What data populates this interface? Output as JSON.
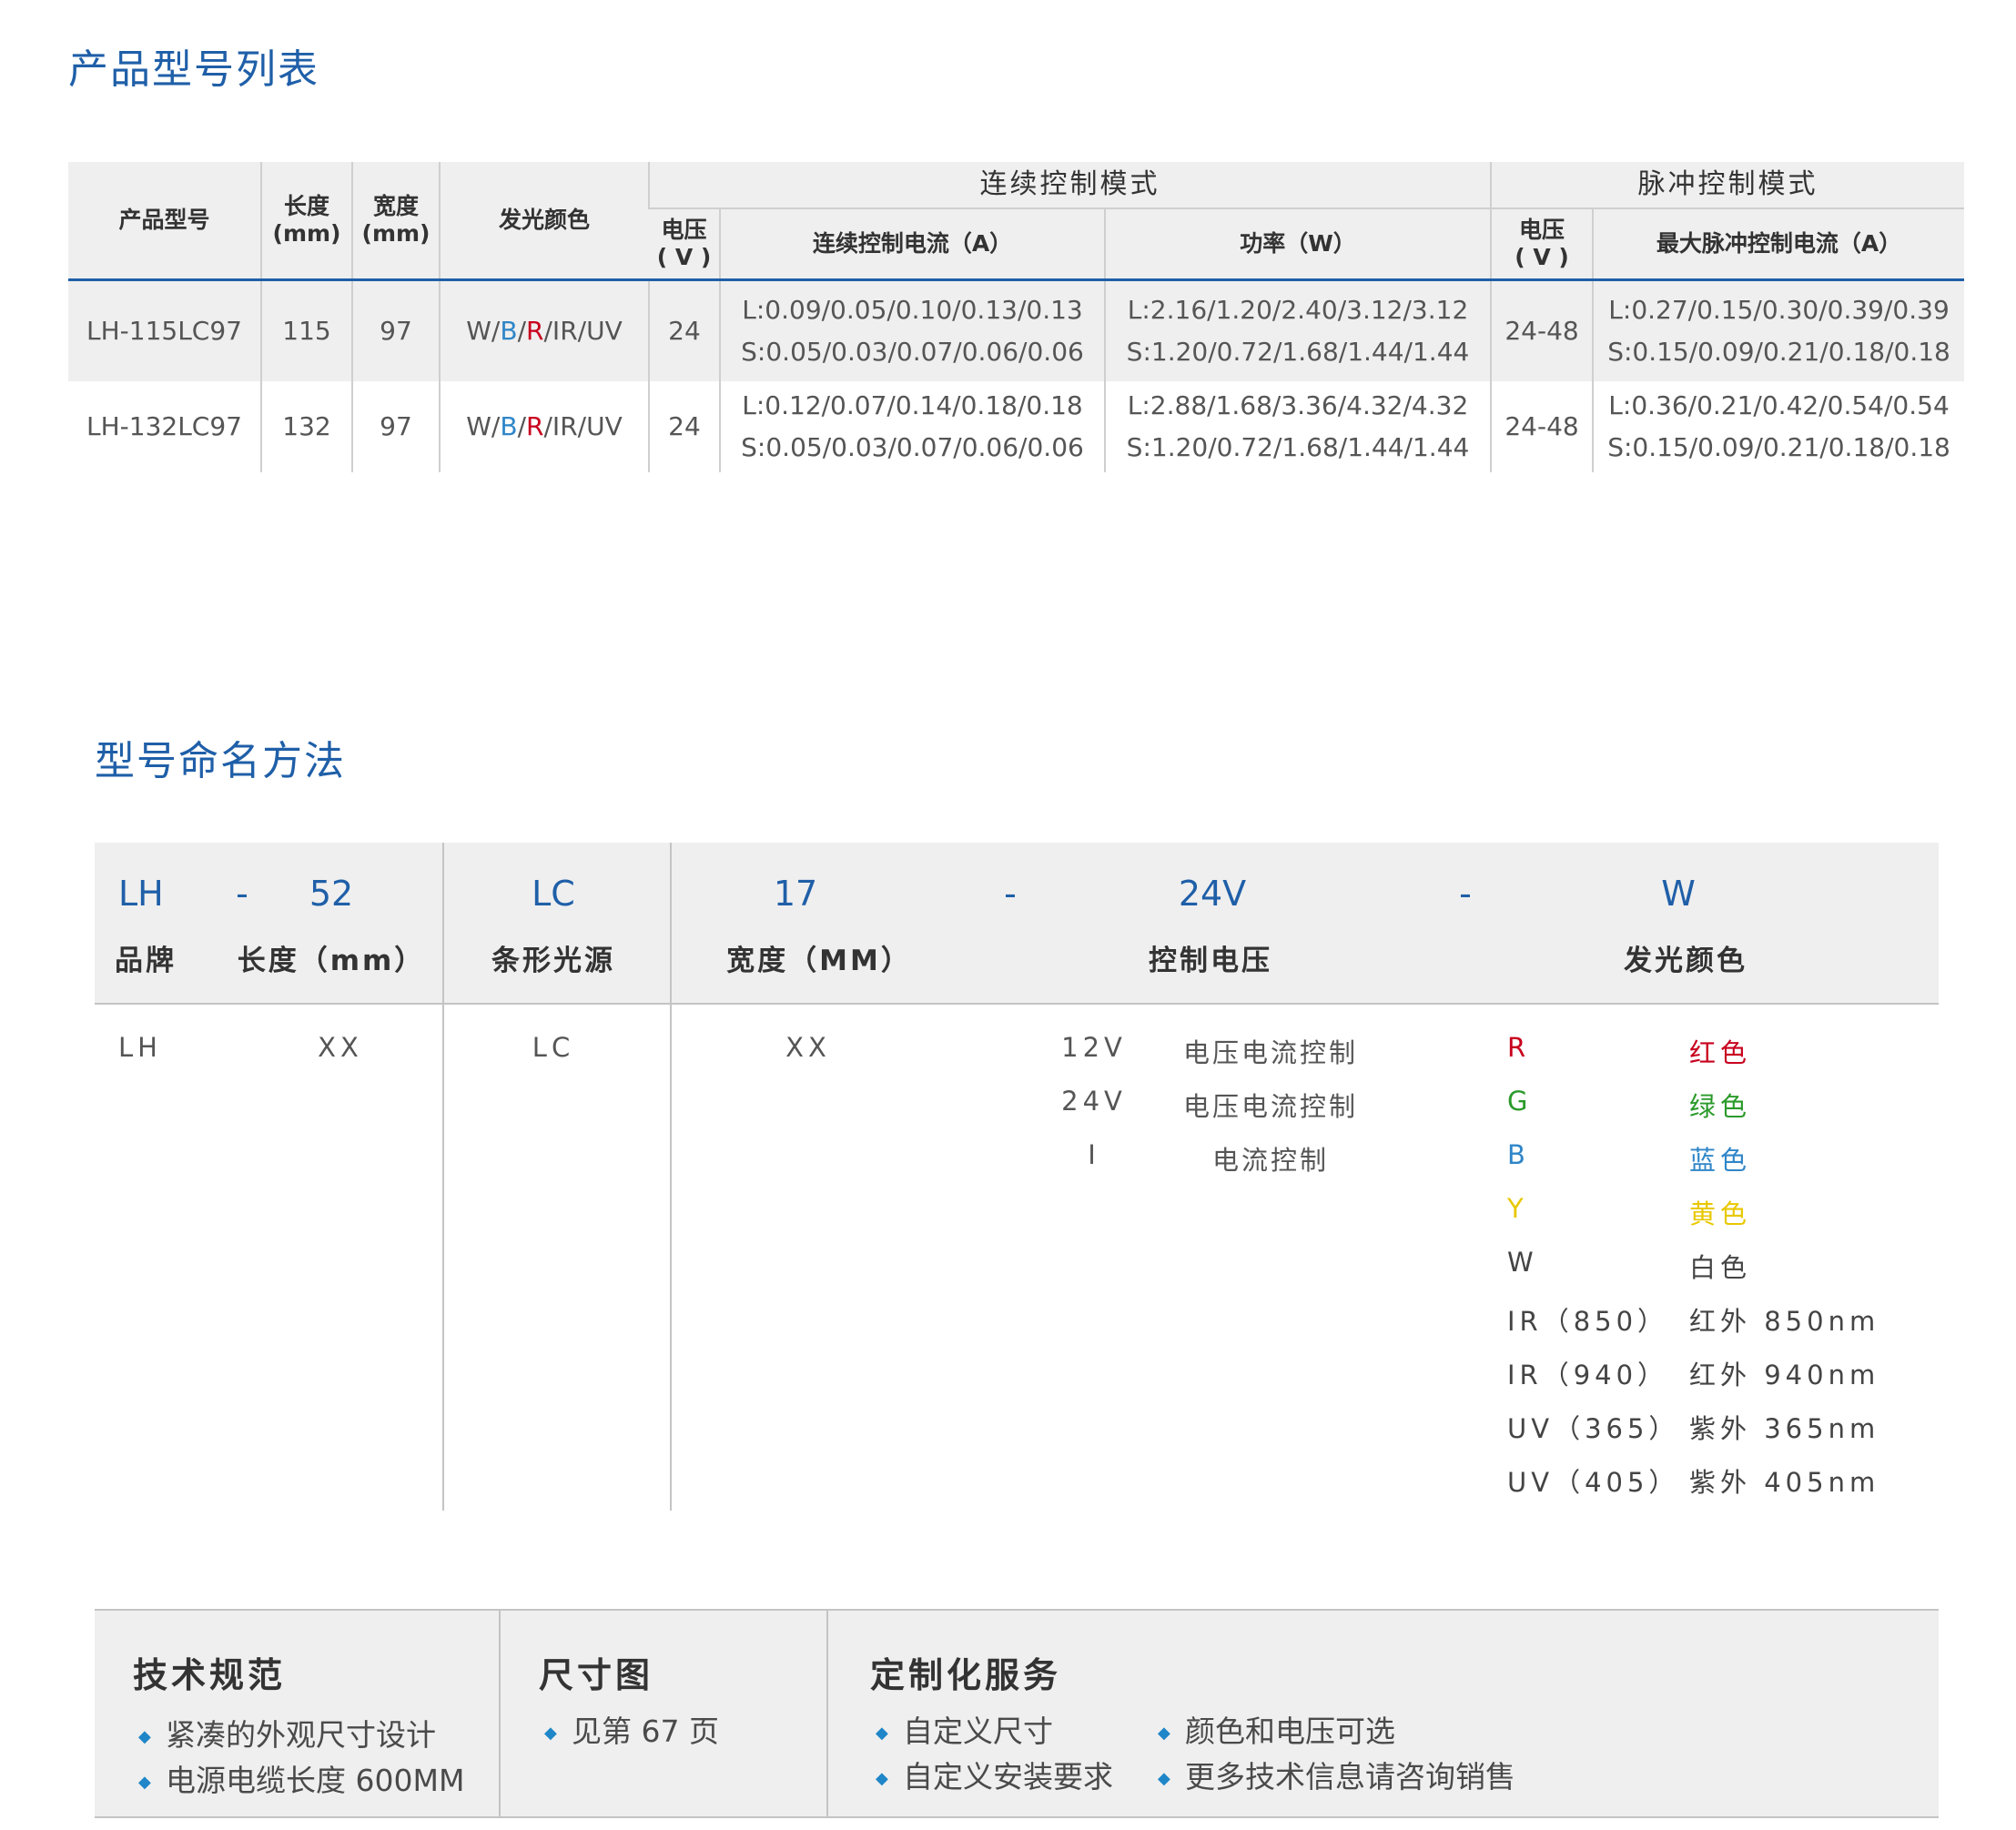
{
  "product_section": {
    "title": "产品型号列表",
    "headers": {
      "model": "产品型号",
      "length": [
        "长度",
        "(mm)"
      ],
      "width": [
        "宽度",
        "(mm)"
      ],
      "color": "发光颜色",
      "continuous_mode": "连续控制模式",
      "pulse_mode": "脉冲控制模式",
      "voltage": [
        "电压",
        "( V )"
      ],
      "cont_current": "连续控制电流（A）",
      "power": "功率（W）",
      "pulse_voltage": [
        "电压",
        "( V )"
      ],
      "max_pulse_current": "最大脉冲控制电流（A）"
    },
    "rows": [
      {
        "model": "LH-115LC97",
        "length": "115",
        "width": "97",
        "color_parts": [
          "W/",
          "B",
          "/",
          "R",
          "/IR/UV"
        ],
        "voltage": "24",
        "cont_current": [
          "L:0.09/0.05/0.10/0.13/0.13",
          "S:0.05/0.03/0.07/0.06/0.06"
        ],
        "power": [
          "L:2.16/1.20/2.40/3.12/3.12",
          "S:1.20/0.72/1.68/1.44/1.44"
        ],
        "pulse_voltage": "24-48",
        "pulse_current": [
          "L:0.27/0.15/0.30/0.39/0.39",
          "S:0.15/0.09/0.21/0.18/0.18"
        ]
      },
      {
        "model": "LH-132LC97",
        "length": "132",
        "width": "97",
        "color_parts": [
          "W/",
          "B",
          "/",
          "R",
          "/IR/UV"
        ],
        "voltage": "24",
        "cont_current": [
          "L:0.12/0.07/0.14/0.18/0.18",
          "S:0.05/0.03/0.07/0.06/0.06"
        ],
        "power": [
          "L:2.88/1.68/3.36/4.32/4.32",
          "S:1.20/0.72/1.68/1.44/1.44"
        ],
        "pulse_voltage": "24-48",
        "pulse_current": [
          "L:0.36/0.21/0.42/0.54/0.54",
          "S:0.15/0.09/0.21/0.18/0.18"
        ]
      }
    ]
  },
  "naming_section": {
    "title": "型号命名方法",
    "codes": {
      "brand": "LH",
      "dash1": "-",
      "length": "52",
      "type": "LC",
      "width": "17",
      "dash2": "-",
      "voltage": "24V",
      "dash3": "-",
      "color": "W"
    },
    "labels": {
      "brand": "品牌",
      "length": "长度（mm）",
      "type": "条形光源",
      "width": "宽度（MM）",
      "voltage": "控制电压",
      "color": "发光颜色"
    },
    "values": {
      "brand": "LH",
      "length": "XX",
      "type": "LC",
      "width": "XX"
    },
    "voltage_options": [
      {
        "code": "12V",
        "desc": "电压电流控制"
      },
      {
        "code": "24V",
        "desc": "电压电流控制"
      },
      {
        "code": "I",
        "desc": "电流控制"
      }
    ],
    "color_options": [
      {
        "code": "R",
        "desc": "红色",
        "hex": "#c8001e"
      },
      {
        "code": "G",
        "desc": "绿色",
        "hex": "#2a9a2a"
      },
      {
        "code": "B",
        "desc": "蓝色",
        "hex": "#2f86c8"
      },
      {
        "code": "Y",
        "desc": "黄色",
        "hex": "#e8c800"
      },
      {
        "code": "W",
        "desc": "白色",
        "hex": "#444444"
      },
      {
        "code": "IR（850）",
        "desc": "红外 850nm",
        "hex": "#444444"
      },
      {
        "code": "IR（940）",
        "desc": "红外 940nm",
        "hex": "#444444"
      },
      {
        "code": "UV（365）",
        "desc": "紫外 365nm",
        "hex": "#444444"
      },
      {
        "code": "UV（405）",
        "desc": "紫外 405nm",
        "hex": "#444444"
      }
    ]
  },
  "footer": {
    "tech": {
      "title": "技术规范",
      "items": [
        "紧凑的外观尺寸设计",
        "电源电缆长度 600MM"
      ]
    },
    "dimension": {
      "title": "尺寸图",
      "items": [
        "见第 67 页"
      ]
    },
    "custom": {
      "title": "定制化服务",
      "items": [
        "自定义尺寸",
        "自定义安装要求",
        "颜色和电压可选",
        "更多技术信息请咨询销售"
      ]
    },
    "bullet": "◆"
  }
}
